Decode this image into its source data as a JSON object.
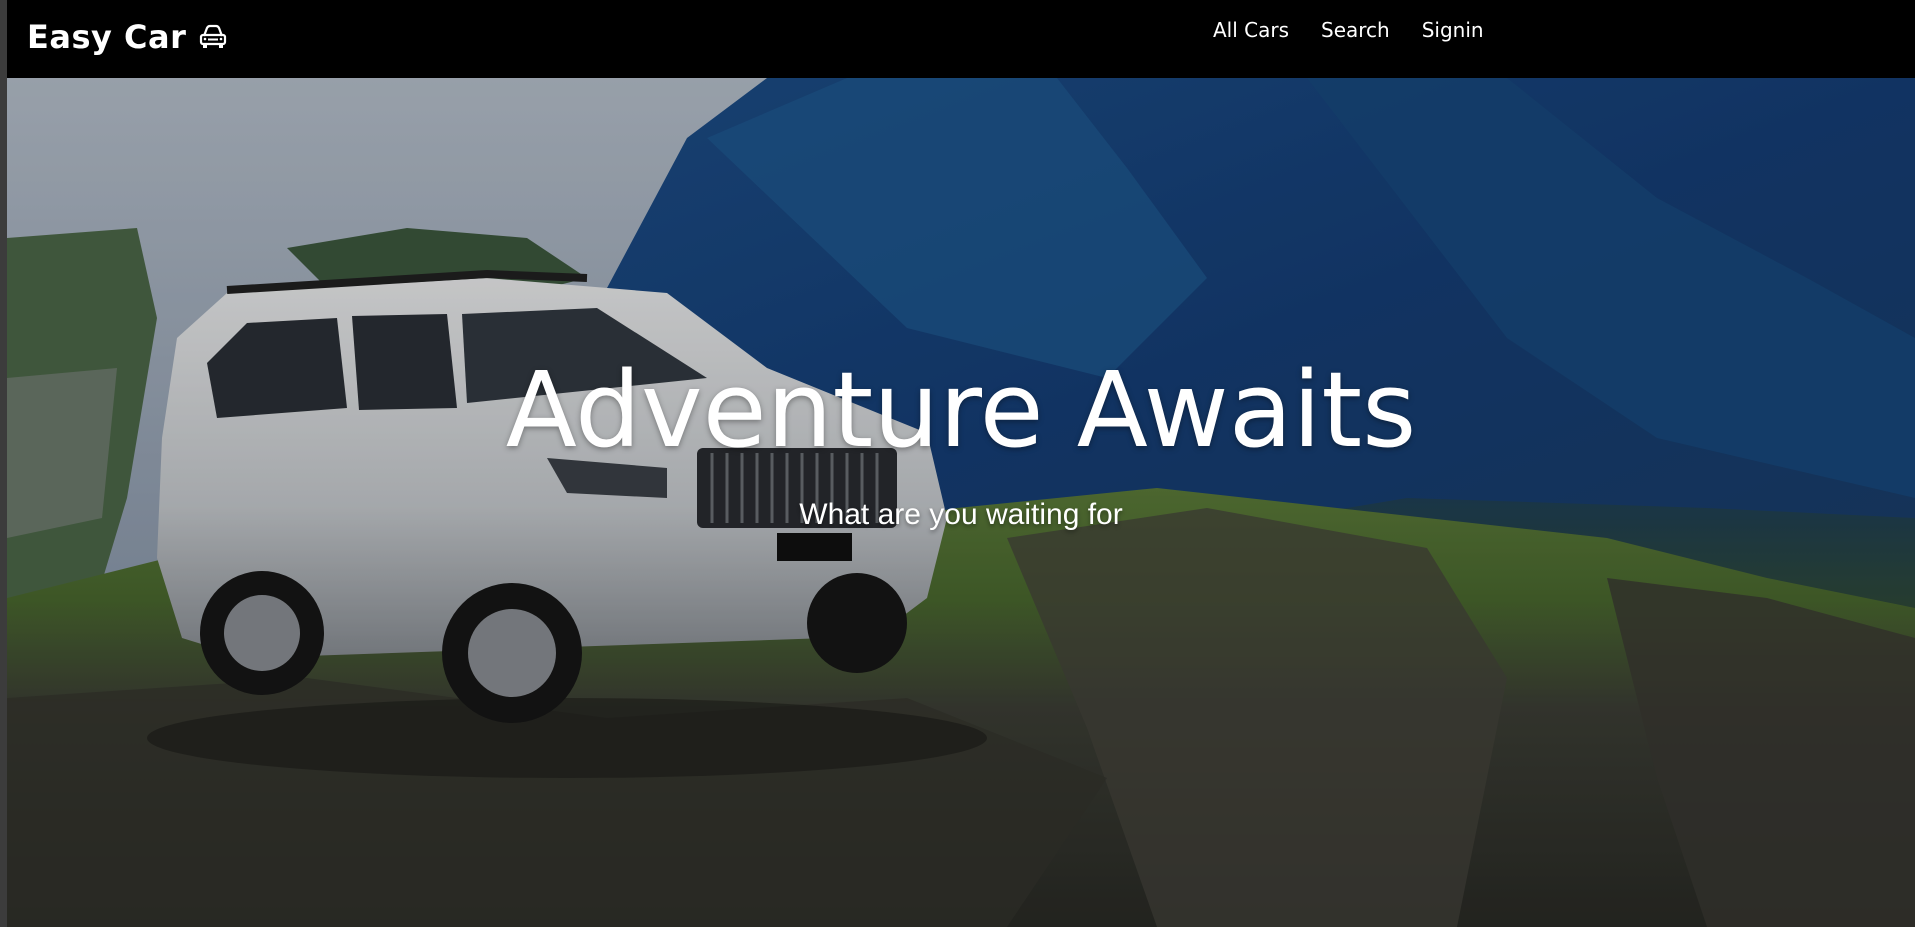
{
  "navbar": {
    "brand": "Easy Car",
    "brand_icon": "car-icon",
    "links": [
      {
        "label": "All Cars"
      },
      {
        "label": "Search"
      },
      {
        "label": "Signin"
      }
    ]
  },
  "hero": {
    "title": "Adventure Awaits",
    "subtitle": "What are you waiting for",
    "image_description_icon": "suv-on-cliff-image"
  },
  "colors": {
    "navbar_bg": "#000000",
    "text": "#ffffff"
  }
}
